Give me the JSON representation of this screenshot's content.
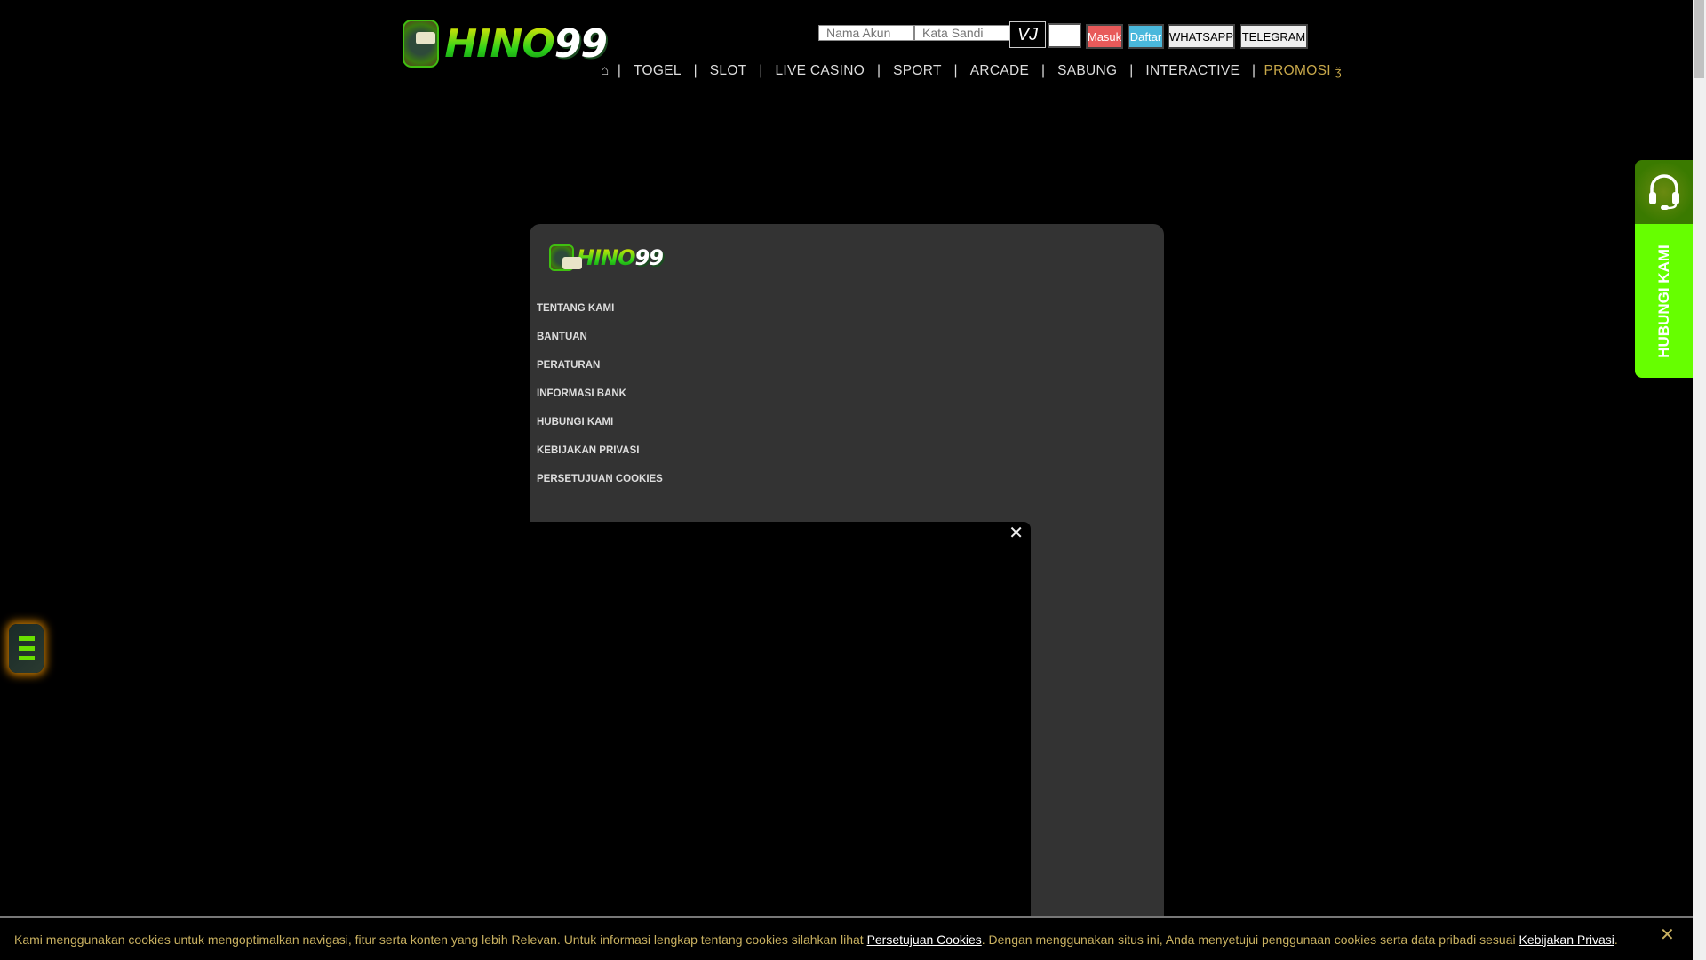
{
  "brand": {
    "name_green": "HINO",
    "name_white": "99"
  },
  "login": {
    "username_placeholder": "Nama Akun",
    "password_placeholder": "Kata Sandi",
    "captcha_text": "VJ",
    "login_label": "Masuk",
    "register_label": "Daftar",
    "whatsapp_label": "WHATSAPP",
    "telegram_label": "TELEGRAM"
  },
  "nav": {
    "home": "⌂",
    "items": [
      "TOGEL",
      "SLOT",
      "LIVE CASINO",
      "SPORT",
      "ARCADE",
      "SABUNG",
      "INTERACTIVE"
    ],
    "promo": "PROMOSI",
    "separator": "|"
  },
  "footer_menu": [
    "TENTANG KAMI",
    "BANTUAN",
    "PERATURAN",
    "INFORMASI BANK",
    "HUBUNGI KAMI",
    "KEBIJAKAN PRIVASI",
    "PERSETUJUAN COOKIES"
  ],
  "contact": {
    "label": "HUBUNGI KAMI"
  },
  "cookie": {
    "text1": "Kami menggunakan cookies untuk mengoptimalkan navigasi, fitur serta konten yang lebih Relevan. Untuk informasi lengkap tentang cookies silahkan lihat ",
    "link1": "Persetujuan Cookies",
    "text2": ". Dengan menggunakan situs ini, Anda menyetujui penggunaan cookies serta data pribadi sesuai ",
    "link2": "Kebijakan Privasi",
    "text3": ".",
    "close": "✕"
  },
  "modal": {
    "close": "✕"
  },
  "colors": {
    "masuk": "#e85a5a",
    "daftar": "#4ab8dc",
    "promo": "#c8a84a",
    "contact_green": "#66ff00"
  }
}
